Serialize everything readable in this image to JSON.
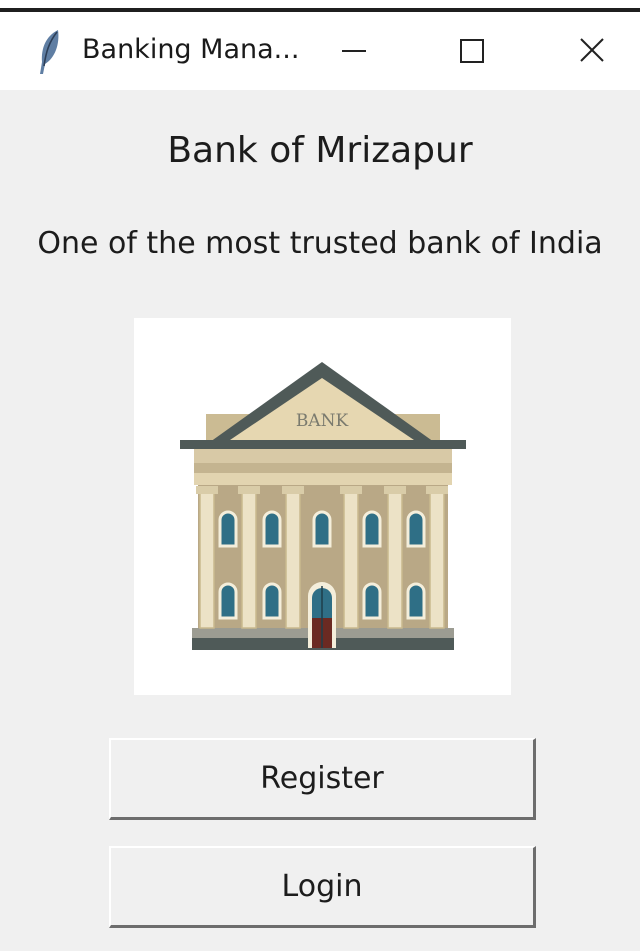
{
  "window": {
    "title": "Banking Mana...",
    "icon": "feather-icon",
    "controls": [
      "minimize-icon",
      "maximize-icon",
      "close-icon"
    ]
  },
  "main": {
    "bank_name": "Bank of Mrizapur",
    "tagline": "One of the most trusted bank of India",
    "image": {
      "icon": "bank-building-icon",
      "sign_text": "BANK"
    },
    "register_label": "Register",
    "login_label": "Login"
  },
  "colors": {
    "background": "#f0f0f0",
    "titlebar": "#ffffff",
    "roof": "#4f5a58",
    "facade": "#d8c9a6",
    "window_glass": "#2f6f86"
  }
}
